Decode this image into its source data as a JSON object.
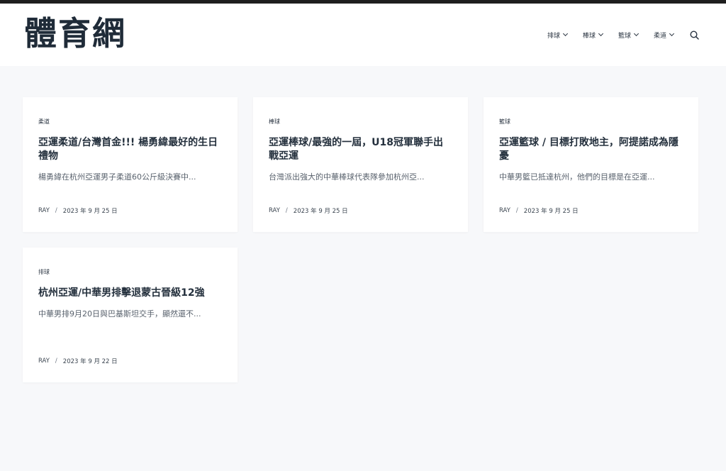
{
  "site": {
    "logo": "體育網"
  },
  "nav": {
    "items": [
      {
        "label": "排球"
      },
      {
        "label": "棒球"
      },
      {
        "label": "籃球"
      },
      {
        "label": "柔道"
      }
    ],
    "search_icon": "search-icon"
  },
  "posts": [
    {
      "category": "柔道",
      "title": "亞運柔道/台灣首金!!! 楊勇緯最好的生日禮物",
      "excerpt": "楊勇緯在杭州亞運男子柔道60公斤級決賽中...",
      "author": "RAY",
      "separator": "/",
      "date": "2023 年 9 月 25 日"
    },
    {
      "category": "棒球",
      "title": "亞運棒球/最強的一屆，U18冠軍聯手出戰亞運",
      "excerpt": "台灣派出強大的中華棒球代表隊參加杭州亞...",
      "author": "RAY",
      "separator": "/",
      "date": "2023 年 9 月 25 日"
    },
    {
      "category": "籃球",
      "title": "亞運籃球 / 目標打敗地主，阿提諾成為隱憂",
      "excerpt": "中華男籃已抵達杭州，他們的目標是在亞運...",
      "author": "RAY",
      "separator": "/",
      "date": "2023 年 9 月 25 日"
    },
    {
      "category": "排球",
      "title": "杭州亞運/中華男排擊退蒙古晉級12強",
      "excerpt": "中華男排9月20日與巴基斯坦交手，顯然還不...",
      "author": "RAY",
      "separator": "/",
      "date": "2023 年 9 月 22 日"
    }
  ]
}
